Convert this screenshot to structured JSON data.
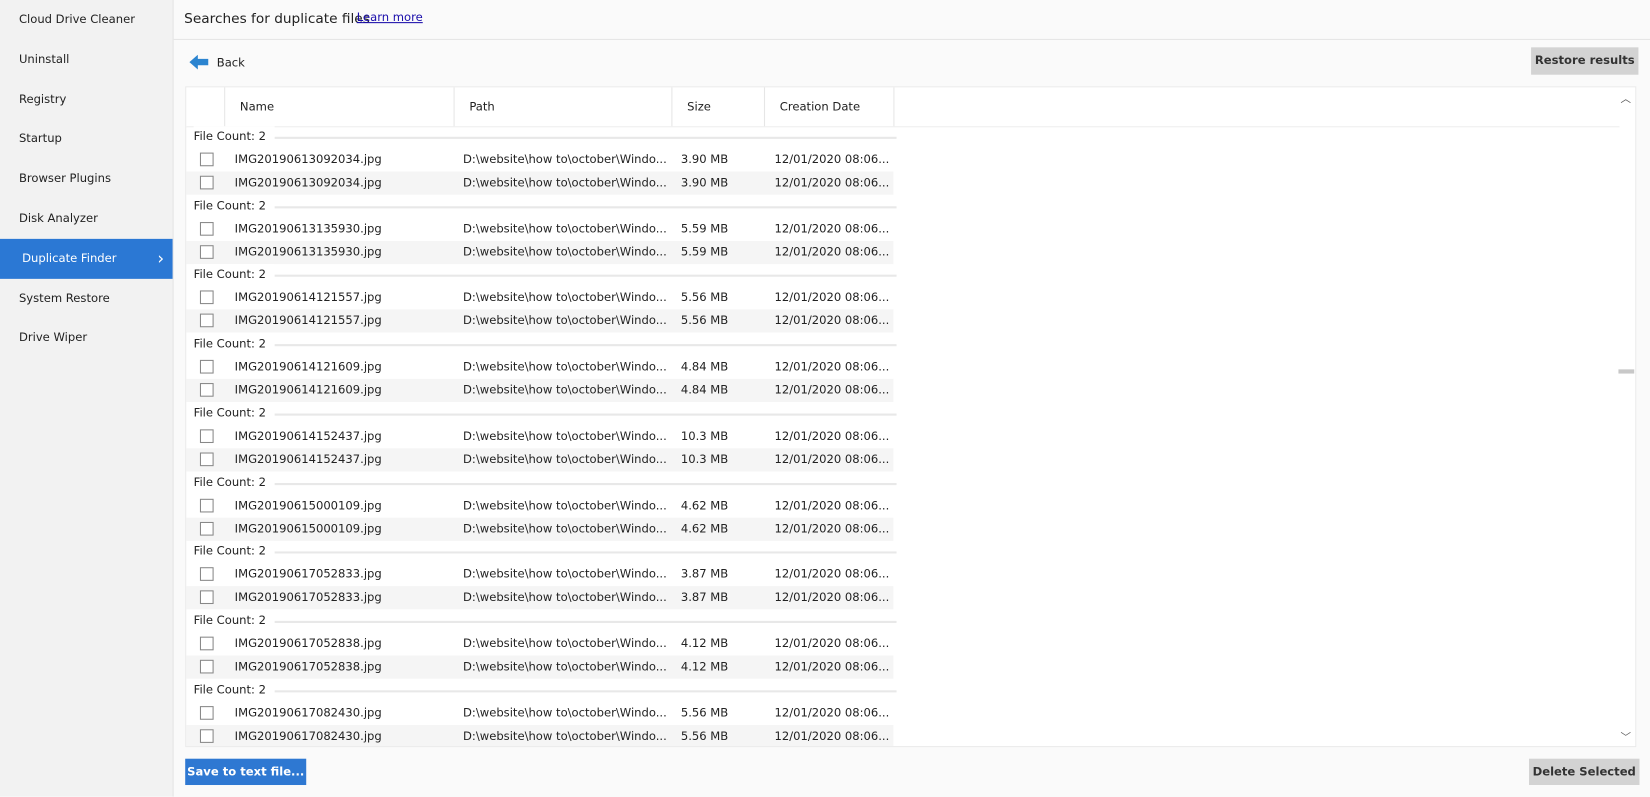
{
  "sidebar": {
    "items": [
      {
        "label": "Cloud Drive Cleaner"
      },
      {
        "label": "Uninstall"
      },
      {
        "label": "Registry"
      },
      {
        "label": "Startup"
      },
      {
        "label": "Browser Plugins"
      },
      {
        "label": "Disk Analyzer"
      },
      {
        "label": "Duplicate Finder",
        "active": true
      },
      {
        "label": "System Restore"
      },
      {
        "label": "Drive Wiper"
      }
    ]
  },
  "header": {
    "title": "Searches for duplicate files",
    "learn_more": "Learn more"
  },
  "toolbar": {
    "back": "Back",
    "restore": "Restore results"
  },
  "table": {
    "columns": [
      "Name",
      "Path",
      "Size",
      "Creation Date"
    ],
    "groups": [
      {
        "label": "File Count: 2",
        "name": "IMG20190613092034.jpg",
        "size": "3.90 MB"
      },
      {
        "label": "File Count: 2",
        "name": "IMG20190613135930.jpg",
        "size": "5.59 MB"
      },
      {
        "label": "File Count: 2",
        "name": "IMG20190614121557.jpg",
        "size": "5.56 MB"
      },
      {
        "label": "File Count: 2",
        "name": "IMG20190614121609.jpg",
        "size": "4.84 MB"
      },
      {
        "label": "File Count: 2",
        "name": "IMG20190614152437.jpg",
        "size": "10.3 MB"
      },
      {
        "label": "File Count: 2",
        "name": "IMG20190615000109.jpg",
        "size": "4.62 MB"
      },
      {
        "label": "File Count: 2",
        "name": "IMG20190617052833.jpg",
        "size": "3.87 MB"
      },
      {
        "label": "File Count: 2",
        "name": "IMG20190617052838.jpg",
        "size": "4.12 MB"
      },
      {
        "label": "File Count: 2",
        "name": "IMG20190617082430.jpg",
        "size": "5.56 MB"
      }
    ],
    "path": "D:\\website\\how to\\october\\Windo...",
    "date": "12/01/2020 08:06..."
  },
  "footer": {
    "save": "Save to text file...",
    "delete": "Delete Selected"
  },
  "colors": {
    "accent": "#2b78d4"
  }
}
